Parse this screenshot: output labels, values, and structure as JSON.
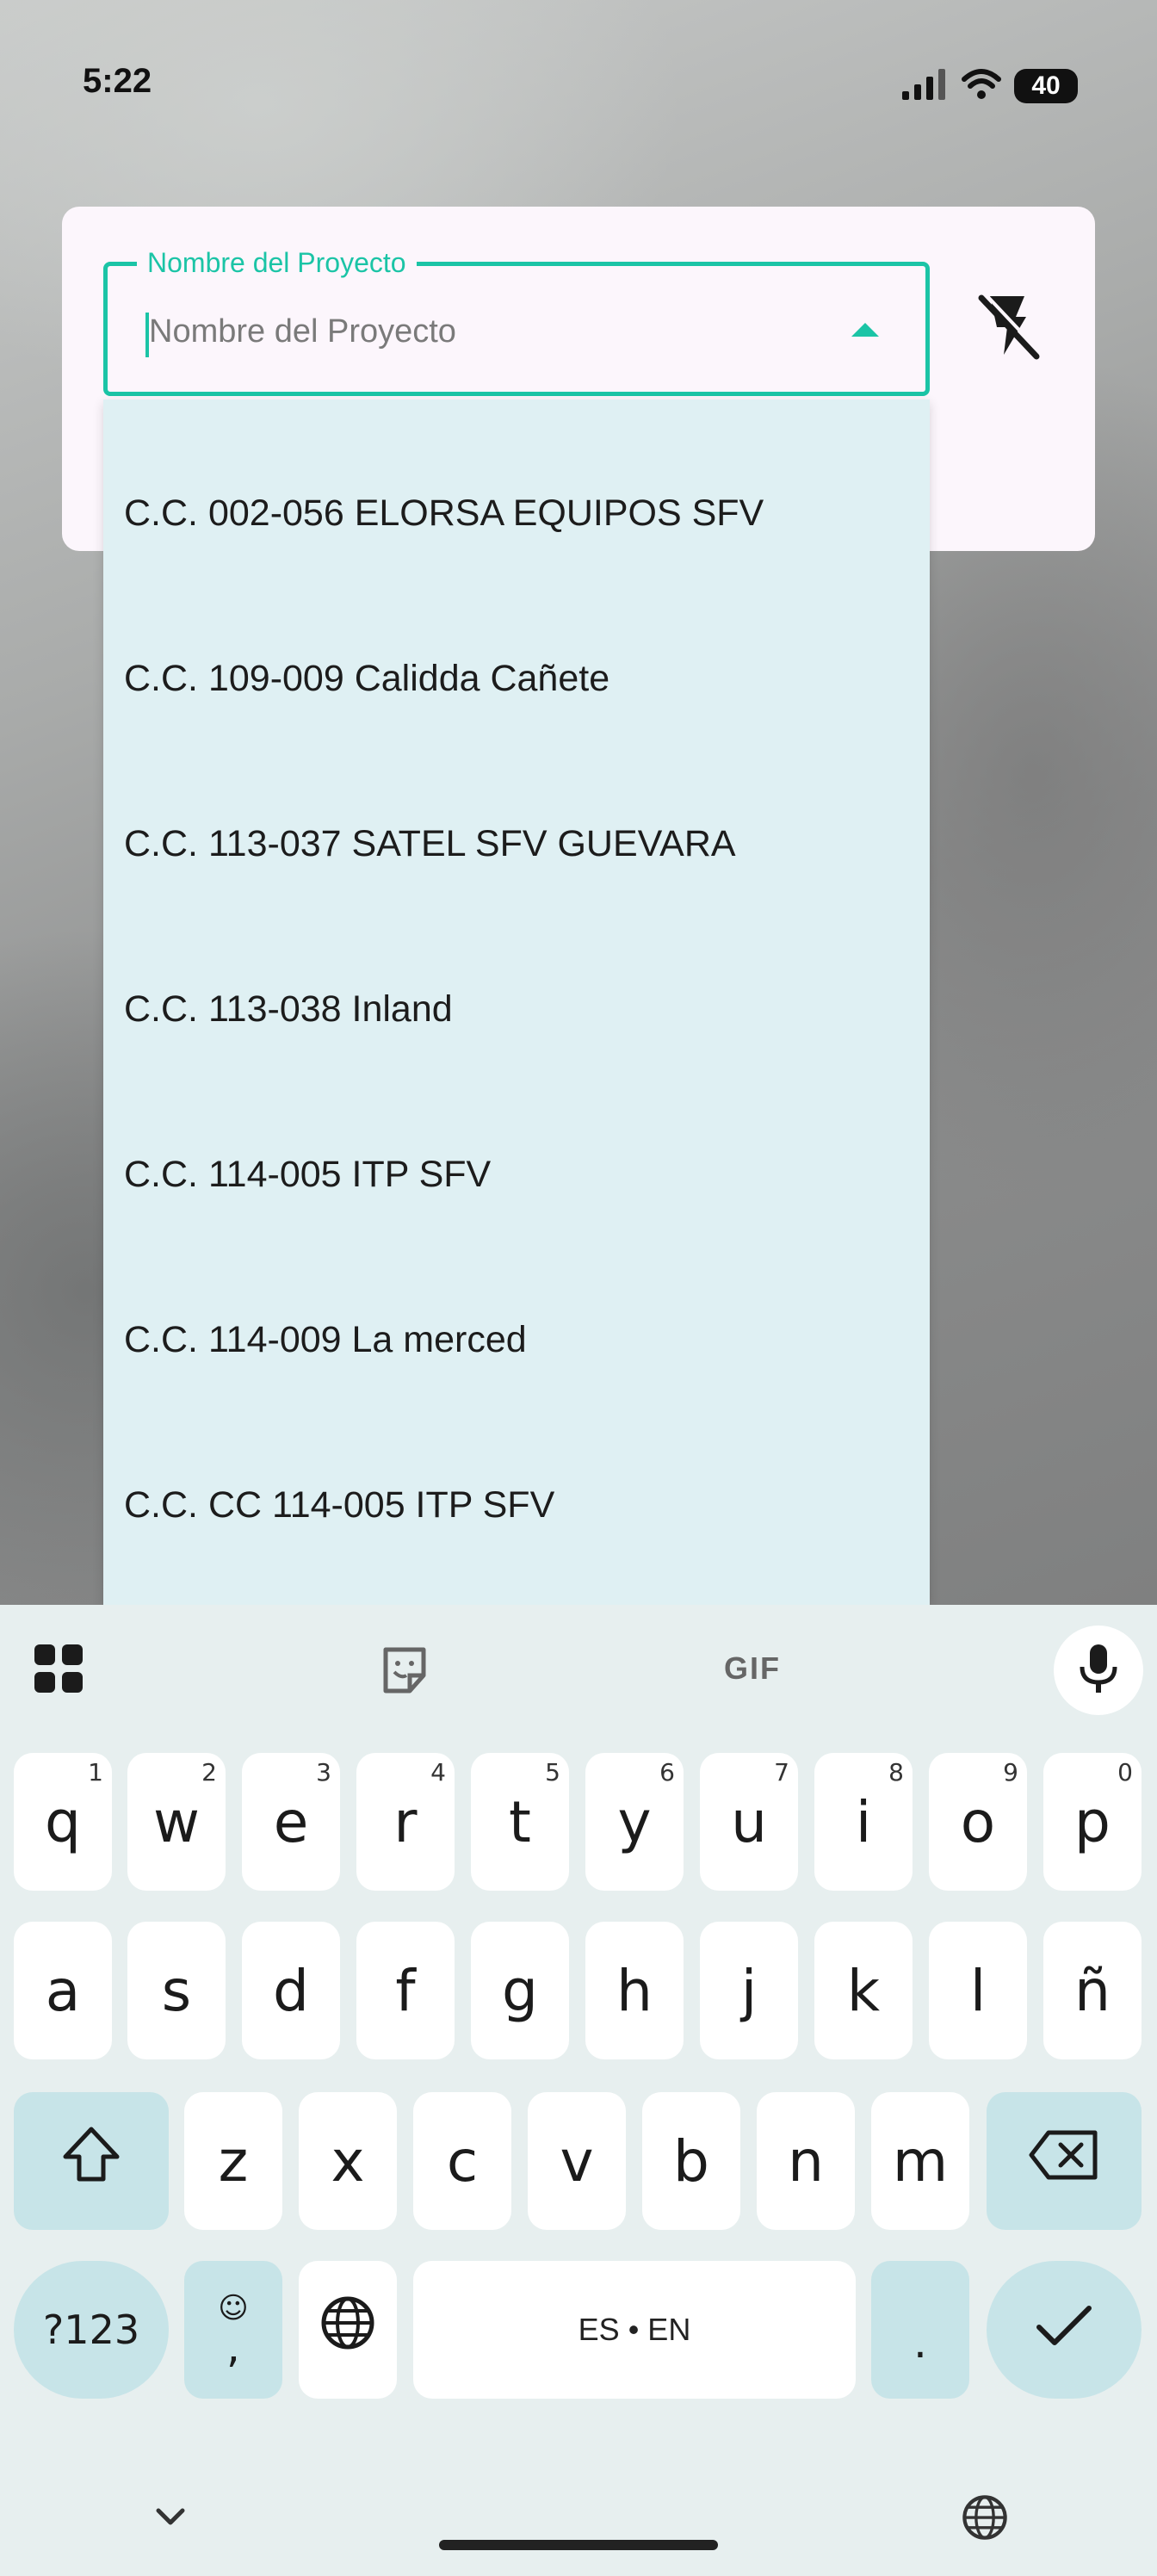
{
  "status_bar": {
    "time": "5:22",
    "battery": "40",
    "icons": [
      "signal-icon",
      "wifi-icon",
      "battery-icon"
    ]
  },
  "project_field": {
    "label": "Nombre del Proyecto",
    "placeholder": "Nombre del Proyecto",
    "value": ""
  },
  "flash_button": {
    "icon": "flash-off-icon"
  },
  "dropdown": {
    "items": [
      "C.C. 002-056 ELORSA EQUIPOS SFV",
      "C.C. 109-009 Calidda Cañete",
      "C.C. 113-037 SATEL SFV GUEVARA",
      "C.C. 113-038 Inland",
      "C.C. 114-005 ITP SFV",
      "C.C. 114-009 La merced",
      "C.C. CC 114-005 ITP SFV"
    ]
  },
  "keyboard": {
    "toolbar": {
      "apps_icon": "apps-grid-icon",
      "sticker_icon": "sticker-icon",
      "gif_label": "GIF",
      "mic_icon": "mic-icon"
    },
    "row1": [
      {
        "key": "q",
        "hint": "1"
      },
      {
        "key": "w",
        "hint": "2"
      },
      {
        "key": "e",
        "hint": "3"
      },
      {
        "key": "r",
        "hint": "4"
      },
      {
        "key": "t",
        "hint": "5"
      },
      {
        "key": "y",
        "hint": "6"
      },
      {
        "key": "u",
        "hint": "7"
      },
      {
        "key": "i",
        "hint": "8"
      },
      {
        "key": "o",
        "hint": "9"
      },
      {
        "key": "p",
        "hint": "0"
      }
    ],
    "row2": [
      "a",
      "s",
      "d",
      "f",
      "g",
      "h",
      "j",
      "k",
      "l",
      "ñ"
    ],
    "row3": [
      "z",
      "x",
      "c",
      "v",
      "b",
      "n",
      "m"
    ],
    "symbols_label": "?123",
    "emoji_key_label": ",",
    "space_label": "ES • EN",
    "period_label": ".",
    "colors": {
      "accent": "#1bc4a6",
      "special_key": "#c7e4e8",
      "keyboard_bg": "#e7efef",
      "dropdown_bg": "#dff0f3"
    }
  }
}
